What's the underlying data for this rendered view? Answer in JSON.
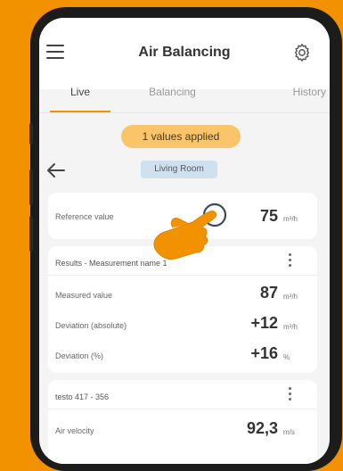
{
  "app": {
    "title": "Air Balancing",
    "tabs": [
      "Live",
      "Balancing",
      "History"
    ],
    "applied_badge": "1 values applied",
    "room_chip": "Living Room"
  },
  "reference": {
    "label": "Reference value",
    "value": "75",
    "unit": "m³/h"
  },
  "results": {
    "header": "Results - Measurement name 1",
    "rows": [
      {
        "label": "Measured value",
        "value": "87",
        "unit": "m³/h"
      },
      {
        "label": "Deviation (absolute)",
        "value": "+12",
        "unit": "m³/h"
      },
      {
        "label": "Deviation (%)",
        "value": "+16",
        "unit": "%"
      }
    ]
  },
  "probe": {
    "header": "testo 417 - 356",
    "rows": [
      {
        "label": "Air velocity",
        "value": "92,3",
        "unit": "m/s"
      }
    ]
  },
  "icons": [
    "menu-icon",
    "gear-icon",
    "back-arrow-icon",
    "more-vert-icon",
    "tap-hand-icon"
  ],
  "colors": {
    "accent": "#F39200",
    "badge": "#F9C46A",
    "chip": "#CFE1EE"
  }
}
